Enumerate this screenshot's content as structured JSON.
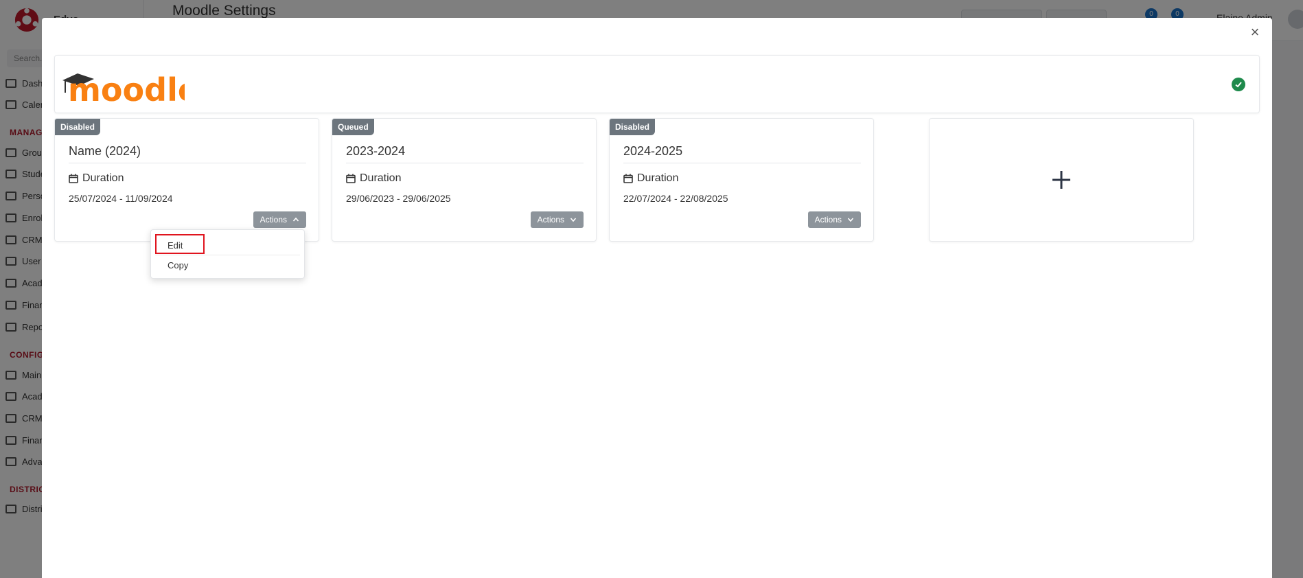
{
  "background": {
    "brand_initial": "Edvo",
    "search_placeholder": "Search...",
    "page_title": "Moodle Settings",
    "sidebar": {
      "items_top": [
        {
          "label": "Dashboard",
          "icon": "monitor-icon"
        },
        {
          "label": "Calendar",
          "icon": "calendar-icon"
        }
      ],
      "heading_manage": "MANAGE",
      "items_manage": [
        {
          "label": "Groups",
          "icon": "groups-icon"
        },
        {
          "label": "Students",
          "icon": "students-icon"
        },
        {
          "label": "Persons",
          "icon": "person-icon"
        },
        {
          "label": "Enrolments",
          "icon": "exchange-icon"
        },
        {
          "label": "CRM",
          "icon": "shuffle-icon"
        },
        {
          "label": "User",
          "icon": "key-icon"
        },
        {
          "label": "Academic",
          "icon": "grid-icon"
        },
        {
          "label": "Finance",
          "icon": "coins-icon"
        },
        {
          "label": "Reports",
          "icon": "printer-icon"
        }
      ],
      "heading_config": "CONFIG",
      "items_config": [
        {
          "label": "Main",
          "icon": "sliders-icon"
        },
        {
          "label": "Academic",
          "icon": "groups-icon"
        },
        {
          "label": "CRM",
          "icon": "shuffle-icon"
        },
        {
          "label": "Finance",
          "icon": "coins-icon"
        },
        {
          "label": "Advanced",
          "icon": "gears-icon"
        }
      ],
      "heading_district": "DISTRICT",
      "items_district": [
        {
          "label": "District",
          "icon": "list-icon"
        }
      ]
    },
    "notifications": [
      "0",
      "0"
    ],
    "user_name": "Elaine Admin"
  },
  "modal": {
    "close_label": "×",
    "provider": "moodle",
    "cards": [
      {
        "status": "Disabled",
        "title": "Name (2024)",
        "duration_label": "Duration",
        "dates": "25/07/2024 - 11/09/2024",
        "actions_label": "Actions",
        "expanded": true
      },
      {
        "status": "Queued",
        "title": "2023-2024",
        "duration_label": "Duration",
        "dates": "29/06/2023 - 29/06/2025",
        "actions_label": "Actions",
        "expanded": false
      },
      {
        "status": "Disabled",
        "title": "2024-2025",
        "duration_label": "Duration",
        "dates": "22/07/2024 - 22/08/2025",
        "actions_label": "Actions",
        "expanded": false
      }
    ],
    "add_symbol": "+",
    "dropdown": {
      "items": [
        {
          "label": "Edit"
        },
        {
          "label": "Copy"
        }
      ]
    }
  },
  "colors": {
    "moodle_orange": "#f98012",
    "status_green": "#1e8a4c",
    "badge_gray": "#6c757d",
    "button_gray": "#8d949b",
    "highlight_red": "#e0141e"
  }
}
